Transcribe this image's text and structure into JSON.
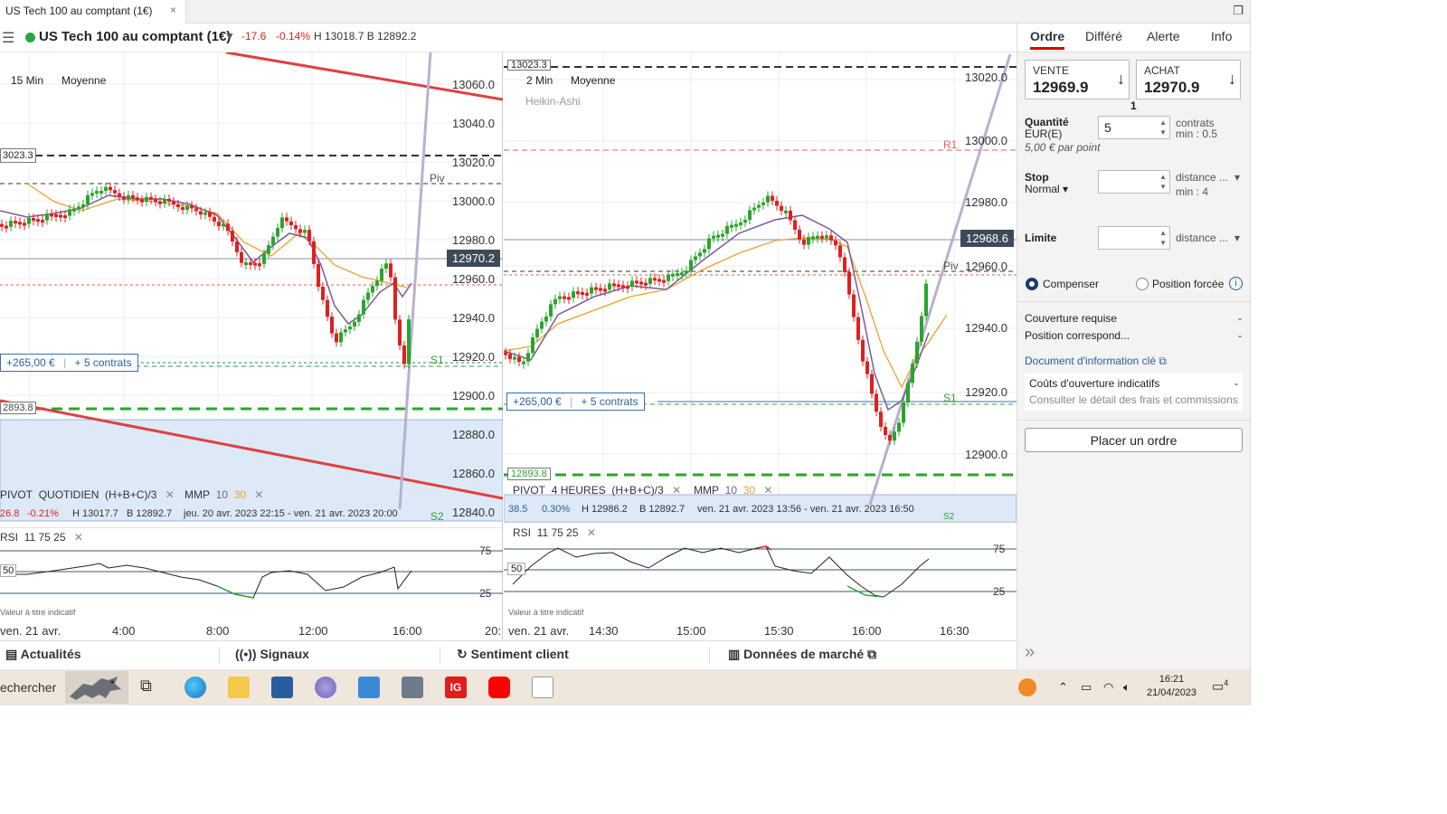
{
  "window": {
    "tab_title": "US Tech 100 au comptant (1€)",
    "tab_close": "×",
    "restore_icon": "❐"
  },
  "header": {
    "menu_icon": "☰",
    "instrument": "US Tech 100 au comptant (1€)",
    "caret": "▼",
    "change": "-17.6",
    "change_pct": "-0.14%",
    "high_low": "H 13018.7 B 12892.2"
  },
  "left_chart": {
    "timeframe": "15 Min",
    "style": "Moyenne",
    "y_ticks": [
      "13060.0",
      "13040.0",
      "13020.0",
      "13000.0",
      "12980.0",
      "12960.0",
      "12940.0",
      "12920.0",
      "12900.0",
      "12880.0",
      "12860.0",
      "12840.0"
    ],
    "price_tag": "12970.2",
    "level_tag_top": "3023.3",
    "level_tag_bottom": "2893.8",
    "piv_label": "Piv",
    "s1_label": "S1",
    "s2_label": "S2",
    "position_pnl": "+265,00 €",
    "position_contracts": "+ 5 contrats",
    "legend_pivot": "PIVOT",
    "legend_pivot_period": "QUOTIDIEN",
    "legend_pivot_formula": "(H+B+C)/3",
    "legend_mmp": "MMP",
    "legend_mmp_a": "10",
    "legend_mmp_b": "30",
    "info_change": "26.8",
    "info_change_pct": "-0.21%",
    "info_high": "H 13017.7",
    "info_low": "B 12892.7",
    "info_range": "jeu. 20 avr. 2023 22:15 - ven. 21 avr. 2023 20:00",
    "rsi_label": "RSI",
    "rsi_params": "11  75  25",
    "rsi_75": "75",
    "rsi_50": "50",
    "rsi_25": "25",
    "note": "Valeur à titre indicatif",
    "x_labels": [
      "ven. 21 avr.",
      "4:00",
      "8:00",
      "12:00",
      "16:00",
      "20:"
    ]
  },
  "right_chart": {
    "timeframe": "2 Min",
    "style": "Moyenne",
    "candle_type": "Heikin-Ashi",
    "y_ticks": [
      "13020.0",
      "13000.0",
      "12980.0",
      "12960.0",
      "12940.0",
      "12920.0",
      "12900.0"
    ],
    "price_tag": "12968.6",
    "level_tag_top": "13023.3",
    "level_tag_bottom": "12893.8",
    "r1_label": "R1",
    "piv_label": "Piv",
    "s1_label": "S1",
    "s2_label": "S2",
    "position_pnl": "+265,00 €",
    "position_contracts": "+ 5 contrats",
    "legend_pivot": "PIVOT",
    "legend_pivot_period": "4 HEURES",
    "legend_pivot_formula": "(H+B+C)/3",
    "legend_mmp": "MMP",
    "legend_mmp_a": "10",
    "legend_mmp_b": "30",
    "info_change": "38.5",
    "info_change_pct": "0.30%",
    "info_high": "H 12986.2",
    "info_low": "B 12892.7",
    "info_range": "ven. 21 avr. 2023 13:56 - ven. 21 avr. 2023 16:50",
    "rsi_label": "RSI",
    "rsi_params": "11  75  25",
    "rsi_75": "75",
    "rsi_50": "50",
    "rsi_25": "25",
    "note": "Valeur à titre indicatif",
    "x_labels": [
      "ven. 21 avr.",
      "14:30",
      "15:00",
      "15:30",
      "16:00",
      "16:30"
    ]
  },
  "bottom_bar": {
    "news": "Actualités",
    "signals": "Signaux",
    "sentiment": "Sentiment client",
    "market_data": "Données de marché"
  },
  "order_panel": {
    "tabs": [
      "Ordre",
      "Différé",
      "Alerte",
      "Info"
    ],
    "sell_label": "VENTE",
    "sell_price": "12969.9",
    "buy_label": "ACHAT",
    "buy_price": "12970.9",
    "spread": "1",
    "quantity_label": "Quantité",
    "quantity_currency": "EUR(E)",
    "quantity_value": "5",
    "quantity_unit": "contrats",
    "quantity_min": "min : 0.5",
    "per_point": "5,00 € par point",
    "stop_label": "Stop",
    "stop_type": "Normal",
    "stop_distance": "distance ...",
    "stop_min": "min : 4",
    "limit_label": "Limite",
    "limit_distance": "distance ...",
    "compensate_label": "Compenser",
    "forced_label": "Position forcée",
    "margin_label": "Couverture requise",
    "margin_value": "-",
    "position_label": "Position correspond...",
    "position_value": "-",
    "kid_link": "Document d'information clé",
    "costs_label": "Coûts d'ouverture indicatifs",
    "costs_value": "-",
    "costs_detail": "Consulter le détail des frais et commissions",
    "place_order": "Placer un ordre",
    "expand_icon": "»"
  },
  "taskbar": {
    "search_text": "echercher",
    "time": "16:21",
    "date": "21/04/2023",
    "notifications": "4"
  },
  "colors": {
    "bull": "#2aa52a",
    "bear": "#e02020",
    "trendline_red": "#e04040",
    "trendline_violet": "#b8b0d0",
    "accent_red": "#dd0000",
    "link_blue": "#2a5da0"
  }
}
